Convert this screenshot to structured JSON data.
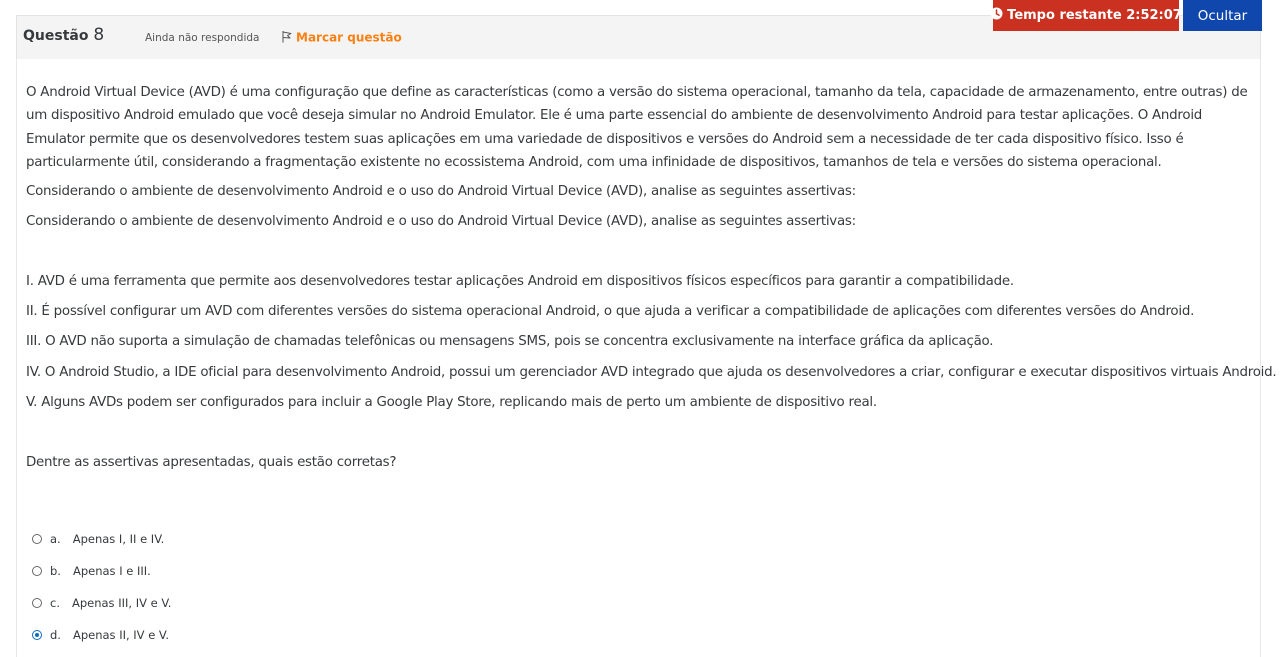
{
  "header": {
    "title": "Questão",
    "number": "8",
    "state": "Ainda não respondida",
    "flag_label": "Marcar questão"
  },
  "timer": {
    "label": "Tempo restante 2:52:07",
    "color": "#ca3120"
  },
  "hide_button": {
    "label": "Ocultar",
    "color": "#0f47ad"
  },
  "question": {
    "intro": "O Android Virtual Device (AVD) é uma configuração que define as características (como a versão do sistema operacional, tamanho da tela, capacidade de armazenamento, entre outras) de um dispositivo Android emulado que você deseja simular no Android Emulator. Ele é uma parte essencial do ambiente de desenvolvimento Android para testar aplicações.  O Android Emulator permite que os desenvolvedores testem suas aplicações em uma variedade de dispositivos e versões do Android sem a necessidade de ter cada dispositivo físico. Isso é particularmente útil, considerando a fragmentação existente no ecossistema Android, com uma infinidade de dispositivos, tamanhos de tela e versões do sistema operacional.",
    "consider_1": "Considerando o ambiente de desenvolvimento Android e o uso do Android Virtual Device (AVD), analise as seguintes assertivas:",
    "consider_2": "Considerando o ambiente de desenvolvimento Android e o uso do Android Virtual Device (AVD), analise as seguintes assertivas:",
    "assertions": [
      "I. AVD é uma ferramenta que permite aos desenvolvedores testar aplicações Android em dispositivos físicos específicos para garantir a compatibilidade.",
      "II. É possível configurar um AVD com diferentes versões do sistema operacional Android, o que ajuda a verificar a compatibilidade de aplicações com diferentes versões do Android.",
      "III. O AVD não suporta a simulação de chamadas telefônicas ou mensagens SMS, pois se concentra exclusivamente na interface gráfica da aplicação.",
      "IV. O Android Studio, a IDE oficial para desenvolvimento Android, possui um gerenciador AVD integrado que ajuda os desenvolvedores a criar, configurar e executar dispositivos virtuais Android.",
      "V. Alguns AVDs podem ser configurados para incluir a Google Play Store, replicando mais de perto um ambiente de dispositivo real."
    ],
    "prompt": "Dentre as assertivas apresentadas, quais estão corretas?"
  },
  "answers": [
    {
      "letter": "a.",
      "text": "Apenas I, II e IV.",
      "checked": false
    },
    {
      "letter": "b.",
      "text": "Apenas I e III.",
      "checked": false
    },
    {
      "letter": "c.",
      "text": "Apenas III, IV e V.",
      "checked": false
    },
    {
      "letter": "d.",
      "text": "Apenas II, IV e V.",
      "checked": true
    }
  ],
  "icons": {
    "flag": "flag-icon",
    "clock": "clock-icon"
  }
}
